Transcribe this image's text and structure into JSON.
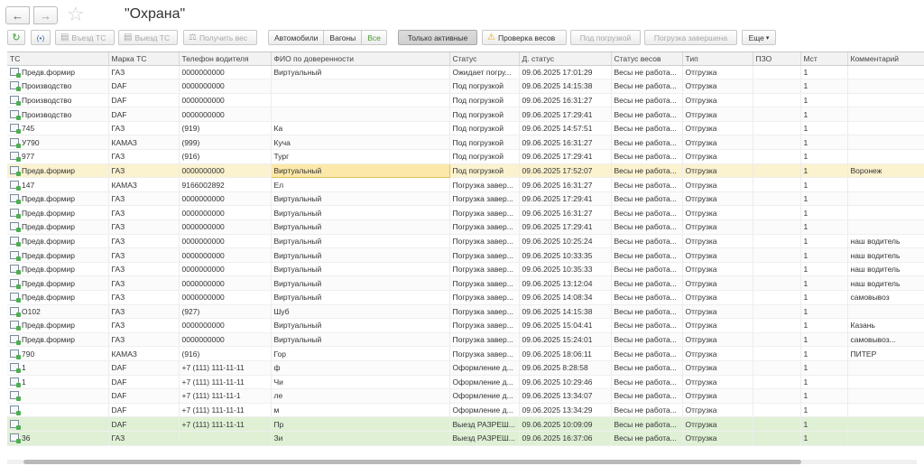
{
  "window": {
    "title": "\"Охрана\""
  },
  "toolbar": {
    "refresh_icon": "refresh-icon",
    "signal_label": "(•)",
    "entry_label": "Въезд ТС",
    "exit_label": "Выезд ТС",
    "get_weight_label": "Получить вес",
    "filter_cars": "Автомобили",
    "filter_wagons": "Вагоны",
    "filter_all": "Все",
    "only_active": "Только активные",
    "check_weights": "Проверка весов",
    "under_loading": "Под погрузкой",
    "loading_done": "Погрузка завершена",
    "more": "Еще"
  },
  "table": {
    "columns": [
      "ТС",
      "Марка ТС",
      "Телефон водителя",
      "ФИО по доверенности",
      "Статус",
      "Д. статус",
      "Статус весов",
      "Тип",
      "ПЗО",
      "Мст",
      "Комментарий"
    ],
    "rows": [
      {
        "ts": "Предв.формир",
        "brand": "ГАЗ",
        "phone": "0000000000",
        "fio": "Виртуальный",
        "status": "Ожидает погру...",
        "date": "09.06.2025 17:01:29",
        "weights": "Весы не работа...",
        "type": "Отгрузка",
        "pzo": "",
        "mst": "1",
        "comment": ""
      },
      {
        "ts": "Производство",
        "brand": "DAF",
        "phone": "0000000000",
        "fio": "",
        "status": "Под погрузкой",
        "date": "09.06.2025 14:15:38",
        "weights": "Весы не работа...",
        "type": "Отгрузка",
        "pzo": "",
        "mst": "1",
        "comment": ""
      },
      {
        "ts": "Производство",
        "brand": "DAF",
        "phone": "0000000000",
        "fio": "",
        "status": "Под погрузкой",
        "date": "09.06.2025 16:31:27",
        "weights": "Весы не работа...",
        "type": "Отгрузка",
        "pzo": "",
        "mst": "1",
        "comment": ""
      },
      {
        "ts": "Производство",
        "brand": "DAF",
        "phone": "0000000000",
        "fio": "",
        "status": "Под погрузкой",
        "date": "09.06.2025 17:29:41",
        "weights": "Весы не работа...",
        "type": "Отгрузка",
        "pzo": "",
        "mst": "1",
        "comment": ""
      },
      {
        "ts": "745",
        "brand": "ГАЗ",
        "phone": "(919)",
        "fio": "Ка",
        "status": "Под погрузкой",
        "date": "09.06.2025 14:57:51",
        "weights": "Весы не работа...",
        "type": "Отгрузка",
        "pzo": "",
        "mst": "1",
        "comment": ""
      },
      {
        "ts": "У790",
        "brand": "КАМАЗ",
        "phone": "(999)",
        "fio": "Куча",
        "status": "Под погрузкой",
        "date": "09.06.2025 16:31:27",
        "weights": "Весы не работа...",
        "type": "Отгрузка",
        "pzo": "",
        "mst": "1",
        "comment": ""
      },
      {
        "ts": "977",
        "brand": "ГАЗ",
        "phone": "(916)",
        "fio": "Тург",
        "status": "Под погрузкой",
        "date": "09.06.2025 17:29:41",
        "weights": "Весы не работа...",
        "type": "Отгрузка",
        "pzo": "",
        "mst": "1",
        "comment": ""
      },
      {
        "ts": "Предв.формир",
        "brand": "ГАЗ",
        "phone": "0000000000",
        "fio": "Виртуальный",
        "status": "Под погрузкой",
        "date": "09.06.2025 17:52:07",
        "weights": "Весы не работа...",
        "type": "Отгрузка",
        "pzo": "",
        "mst": "1",
        "comment": "Воронеж"
      },
      {
        "ts": "147",
        "brand": "КАМАЗ",
        "phone": "9166002892",
        "fio": "Ел",
        "status": "Погрузка завер...",
        "date": "09.06.2025 16:31:27",
        "weights": "Весы не работа...",
        "type": "Отгрузка",
        "pzo": "",
        "mst": "1",
        "comment": ""
      },
      {
        "ts": "Предв.формир",
        "brand": "ГАЗ",
        "phone": "0000000000",
        "fio": "Виртуальный",
        "status": "Погрузка завер...",
        "date": "09.06.2025 17:29:41",
        "weights": "Весы не работа...",
        "type": "Отгрузка",
        "pzo": "",
        "mst": "1",
        "comment": ""
      },
      {
        "ts": "Предв.формир",
        "brand": "ГАЗ",
        "phone": "0000000000",
        "fio": "Виртуальный",
        "status": "Погрузка завер...",
        "date": "09.06.2025 16:31:27",
        "weights": "Весы не работа...",
        "type": "Отгрузка",
        "pzo": "",
        "mst": "1",
        "comment": ""
      },
      {
        "ts": "Предв.формир",
        "brand": "ГАЗ",
        "phone": "0000000000",
        "fio": "Виртуальный",
        "status": "Погрузка завер...",
        "date": "09.06.2025 17:29:41",
        "weights": "Весы не работа...",
        "type": "Отгрузка",
        "pzo": "",
        "mst": "1",
        "comment": ""
      },
      {
        "ts": "Предв.формир",
        "brand": "ГАЗ",
        "phone": "0000000000",
        "fio": "Виртуальный",
        "status": "Погрузка завер...",
        "date": "09.06.2025 10:25:24",
        "weights": "Весы не работа...",
        "type": "Отгрузка",
        "pzo": "",
        "mst": "1",
        "comment": "наш водитель"
      },
      {
        "ts": "Предв.формир",
        "brand": "ГАЗ",
        "phone": "0000000000",
        "fio": "Виртуальный",
        "status": "Погрузка завер...",
        "date": "09.06.2025 10:33:35",
        "weights": "Весы не работа...",
        "type": "Отгрузка",
        "pzo": "",
        "mst": "1",
        "comment": "наш водитель"
      },
      {
        "ts": "Предв.формир",
        "brand": "ГАЗ",
        "phone": "0000000000",
        "fio": "Виртуальный",
        "status": "Погрузка завер...",
        "date": "09.06.2025 10:35:33",
        "weights": "Весы не работа...",
        "type": "Отгрузка",
        "pzo": "",
        "mst": "1",
        "comment": "наш водитель"
      },
      {
        "ts": "Предв.формир",
        "brand": "ГАЗ",
        "phone": "0000000000",
        "fio": "Виртуальный",
        "status": "Погрузка завер...",
        "date": "09.06.2025 13:12:04",
        "weights": "Весы не работа...",
        "type": "Отгрузка",
        "pzo": "",
        "mst": "1",
        "comment": "наш водитель"
      },
      {
        "ts": "Предв.формир",
        "brand": "ГАЗ",
        "phone": "0000000000",
        "fio": "Виртуальный",
        "status": "Погрузка завер...",
        "date": "09.06.2025 14:08:34",
        "weights": "Весы не работа...",
        "type": "Отгрузка",
        "pzo": "",
        "mst": "1",
        "comment": "самовывоз"
      },
      {
        "ts": "О102",
        "brand": "ГАЗ",
        "phone": "(927)",
        "fio": "Шуб",
        "status": "Погрузка завер...",
        "date": "09.06.2025 14:15:38",
        "weights": "Весы не работа...",
        "type": "Отгрузка",
        "pzo": "",
        "mst": "1",
        "comment": ""
      },
      {
        "ts": "Предв.формир",
        "brand": "ГАЗ",
        "phone": "0000000000",
        "fio": "Виртуальный",
        "status": "Погрузка завер...",
        "date": "09.06.2025 15:04:41",
        "weights": "Весы не работа...",
        "type": "Отгрузка",
        "pzo": "",
        "mst": "1",
        "comment": "Казань"
      },
      {
        "ts": "Предв.формир",
        "brand": "ГАЗ",
        "phone": "0000000000",
        "fio": "Виртуальный",
        "status": "Погрузка завер...",
        "date": "09.06.2025 15:24:01",
        "weights": "Весы не работа...",
        "type": "Отгрузка",
        "pzo": "",
        "mst": "1",
        "comment": "самовывоз..."
      },
      {
        "ts": "790",
        "brand": "КАМАЗ",
        "phone": "(916)",
        "fio": "Гор",
        "status": "Погрузка завер...",
        "date": "09.06.2025 18:06:11",
        "weights": "Весы не работа...",
        "type": "Отгрузка",
        "pzo": "",
        "mst": "1",
        "comment": "ПИТЕР"
      },
      {
        "ts": "1",
        "brand": "DAF",
        "phone": "+7 (111) 111-11-11",
        "fio": "ф",
        "status": "Оформление д...",
        "date": "09.06.2025 8:28:58",
        "weights": "Весы не работа...",
        "type": "Отгрузка",
        "pzo": "",
        "mst": "1",
        "comment": ""
      },
      {
        "ts": "1",
        "brand": "DAF",
        "phone": "+7 (111) 111-11-11",
        "fio": "Чи",
        "status": "Оформление д...",
        "date": "09.06.2025 10:29:46",
        "weights": "Весы не работа...",
        "type": "Отгрузка",
        "pzo": "",
        "mst": "1",
        "comment": ""
      },
      {
        "ts": "",
        "brand": "DAF",
        "phone": "+7 (111) 111-11-1",
        "fio": "ле",
        "status": "Оформление д...",
        "date": "09.06.2025 13:34:07",
        "weights": "Весы не работа...",
        "type": "Отгрузка",
        "pzo": "",
        "mst": "1",
        "comment": ""
      },
      {
        "ts": "",
        "brand": "DAF",
        "phone": "+7 (111) 111-11-11",
        "fio": "м",
        "status": "Оформление д...",
        "date": "09.06.2025 13:34:29",
        "weights": "Весы не работа...",
        "type": "Отгрузка",
        "pzo": "",
        "mst": "1",
        "comment": ""
      },
      {
        "ts": "",
        "brand": "DAF",
        "phone": "+7 (111) 111-11-11",
        "fio": "Пр",
        "status": "Выезд РАЗРЕШ...",
        "date": "09.06.2025 10:09:09",
        "weights": "Весы не работа...",
        "type": "Отгрузка",
        "pzo": "",
        "mst": "1",
        "comment": ""
      },
      {
        "ts": "36",
        "brand": "ГАЗ",
        "phone": "",
        "fio": "Зи",
        "status": "Выезд РАЗРЕШ...",
        "date": "09.06.2025 16:37:06",
        "weights": "Весы не работа...",
        "type": "Отгрузка",
        "pzo": "",
        "mst": "1",
        "comment": ""
      }
    ]
  }
}
